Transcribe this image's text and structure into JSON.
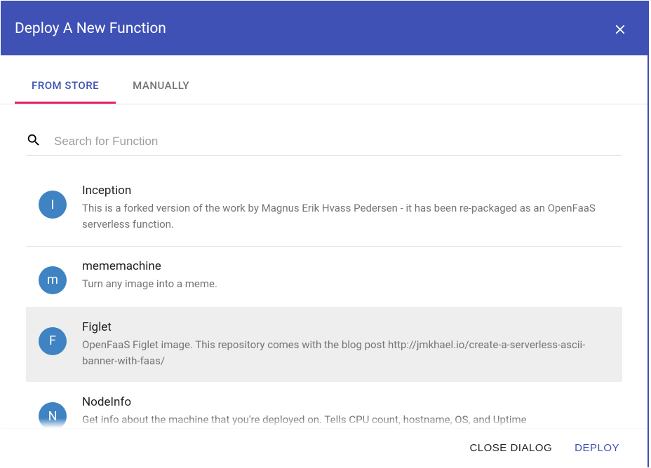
{
  "header": {
    "title": "Deploy A New Function"
  },
  "tabs": [
    {
      "label": "FROM STORE",
      "active": true
    },
    {
      "label": "MANUALLY",
      "active": false
    }
  ],
  "search": {
    "placeholder": "Search for Function",
    "value": ""
  },
  "items": [
    {
      "avatar": "I",
      "title": "Inception",
      "desc": "This is a forked version of the work by Magnus Erik Hvass Pedersen - it has been re-packaged as an OpenFaaS serverless function.",
      "selected": false
    },
    {
      "avatar": "m",
      "title": "mememachine",
      "desc": "Turn any image into a meme.",
      "selected": false
    },
    {
      "avatar": "F",
      "title": "Figlet",
      "desc": "OpenFaaS Figlet image. This repository comes with the blog post http://jmkhael.io/create-a-serverless-ascii-banner-with-faas/",
      "selected": true
    },
    {
      "avatar": "N",
      "title": "NodeInfo",
      "desc": "Get info about the machine that you're deployed on. Tells CPU count, hostname, OS, and Uptime",
      "selected": false
    }
  ],
  "footer": {
    "close": "CLOSE DIALOG",
    "deploy": "DEPLOY"
  }
}
